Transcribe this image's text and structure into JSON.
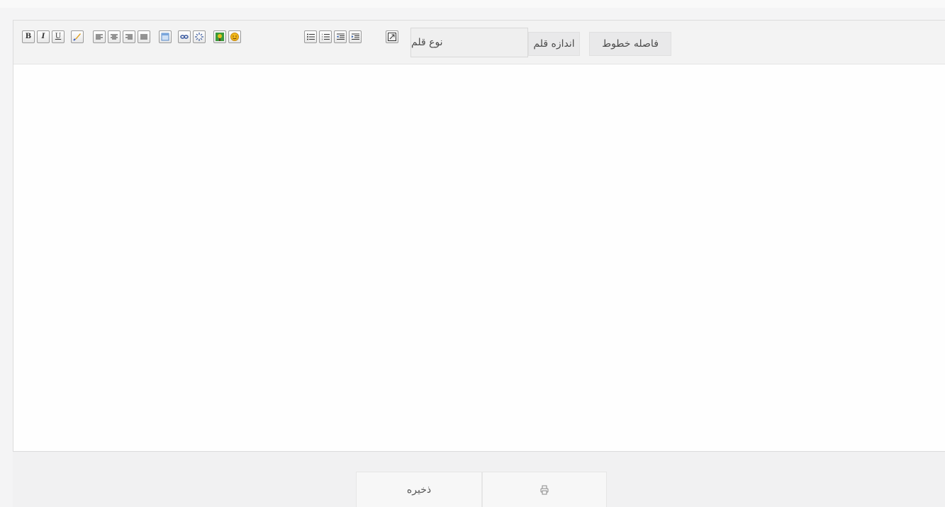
{
  "toolbar": {
    "buttons": [
      {
        "name": "bold-button",
        "glyph": "B"
      },
      {
        "name": "italic-button",
        "glyph": "I"
      },
      {
        "name": "underline-button",
        "glyph": "U"
      },
      {
        "name": "text-color-button",
        "icon": "brush-icon"
      },
      {
        "name": "align-left-button",
        "icon": "align-left-icon"
      },
      {
        "name": "align-center-button",
        "icon": "align-center-icon"
      },
      {
        "name": "align-right-button",
        "icon": "align-right-icon"
      },
      {
        "name": "align-justify-button",
        "icon": "align-justify-icon"
      },
      {
        "name": "insert-table-button",
        "icon": "table-icon"
      },
      {
        "name": "insert-link-button",
        "icon": "link-icon"
      },
      {
        "name": "unlink-button",
        "icon": "unlink-icon"
      },
      {
        "name": "insert-image-button",
        "icon": "image-icon"
      },
      {
        "name": "insert-emoticon-button",
        "icon": "smiley-icon"
      },
      {
        "name": "unordered-list-button",
        "icon": "bullet-list-icon"
      },
      {
        "name": "ordered-list-button",
        "icon": "numbered-list-icon"
      },
      {
        "name": "outdent-button",
        "icon": "outdent-icon"
      },
      {
        "name": "indent-button",
        "icon": "indent-icon"
      },
      {
        "name": "fullscreen-button",
        "icon": "maximize-icon"
      }
    ],
    "font_name_label": "نوع قلم",
    "font_size_label": "اندازه قلم",
    "line_height_label": "فاصله خطوط"
  },
  "footer": {
    "save_label": "ذخیره",
    "print_icon": "printer-icon"
  },
  "colors": {
    "background": "#f4f4f5",
    "editor_bg": "#fdfdfd",
    "toolbar_bg": "#f3f3f3",
    "footer_bg": "#f1f1f2",
    "text": "#4a4a4a"
  }
}
